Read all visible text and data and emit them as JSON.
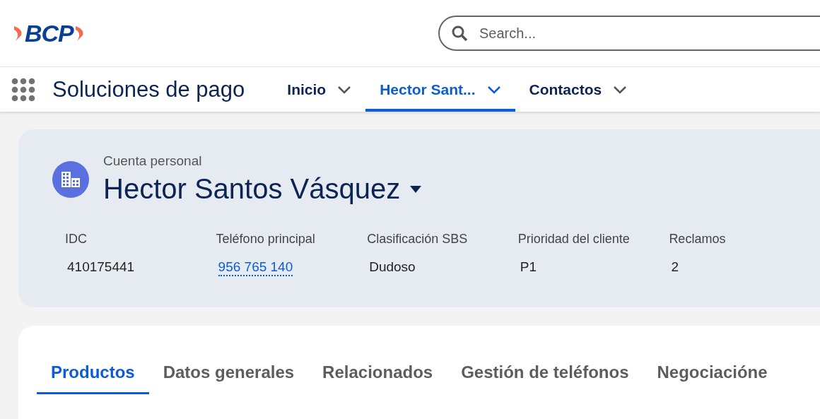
{
  "header": {
    "logo": "BCP",
    "search": {
      "placeholder": "Search..."
    }
  },
  "nav": {
    "app_name": "Soluciones de pago",
    "tabs": [
      {
        "label": "Inicio",
        "selected": false
      },
      {
        "label": "Hector Sant...",
        "selected": true
      },
      {
        "label": "Contactos",
        "selected": false
      }
    ]
  },
  "record": {
    "type_label": "Cuenta personal",
    "name": "Hector Santos Vásquez",
    "fields": [
      {
        "label": "IDC",
        "value": "410175441",
        "kind": "text"
      },
      {
        "label": "Teléfono principal",
        "value": "956 765 140",
        "kind": "link"
      },
      {
        "label": "Clasificación SBS",
        "value": "Dudoso",
        "kind": "text"
      },
      {
        "label": "Prioridad del cliente",
        "value": "P1",
        "kind": "text"
      },
      {
        "label": "Reclamos",
        "value": "2",
        "kind": "text"
      }
    ]
  },
  "detail_tabs": [
    {
      "label": "Productos",
      "selected": true
    },
    {
      "label": "Datos generales",
      "selected": false
    },
    {
      "label": "Relacionados",
      "selected": false
    },
    {
      "label": "Gestión de teléfonos",
      "selected": false
    },
    {
      "label": "Negociacióne",
      "selected": false
    }
  ]
}
